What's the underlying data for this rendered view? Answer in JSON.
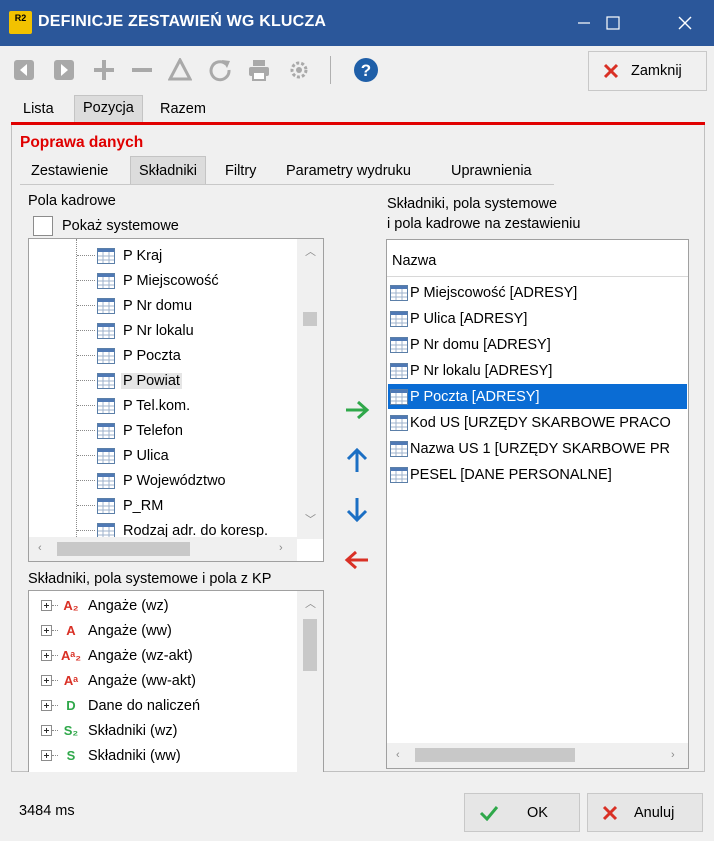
{
  "window": {
    "logo": "R2",
    "title": "DEFINICJE ZESTAWIEŃ WG KLUCZA",
    "icons": [
      "minimize-icon",
      "maximize-icon",
      "close-icon"
    ]
  },
  "toolbar": {
    "icons": [
      "first-record-icon",
      "last-record-icon",
      "add-icon",
      "remove-icon",
      "warning-triangle-icon",
      "refresh-icon",
      "print-icon",
      "settings-icon",
      "help-icon"
    ],
    "close_label": "Zamknij"
  },
  "main_tabs": [
    "Lista",
    "Pozycja",
    "Razem"
  ],
  "section_title": "Poprawa danych",
  "sub_tabs": [
    "Zestawienie",
    "Składniki",
    "Filtry",
    "Parametry wydruku",
    "Uprawnienia"
  ],
  "left_panel": {
    "label": "Pola kadrowe",
    "show_system_label": "Pokaż systemowe",
    "fields": [
      "P Kraj",
      "P Miejscowość",
      "P Nr domu",
      "P Nr lokalu",
      "P Poczta",
      "P Powiat",
      "P Tel.kom.",
      "P Telefon",
      "P Ulica",
      "P Województwo",
      "P_RM",
      "Rodzaj adr. do koresp."
    ],
    "selected_field": "P Powiat",
    "kp_label": "Składniki, pola systemowe i pola z KP",
    "kp_items": [
      {
        "icon": "A₂",
        "label": "Angaże (wz)"
      },
      {
        "icon": "A",
        "label": "Angaże (ww)"
      },
      {
        "icon": "Aᵃ₂",
        "label": "Angaże (wz-akt)"
      },
      {
        "icon": "Aᵃ",
        "label": "Angaże (ww-akt)"
      },
      {
        "icon": "D",
        "label": "Dane do naliczeń"
      },
      {
        "icon": "S₂",
        "label": "Składniki (wz)"
      },
      {
        "icon": "S",
        "label": "Składniki (ww)"
      }
    ]
  },
  "right_panel": {
    "label_line1": "Składniki, pola systemowe",
    "label_line2": "i pola kadrowe na zestawieniu",
    "column_header": "Nazwa",
    "items": [
      "P Miejscowość [ADRESY]",
      "P Ulica [ADRESY]",
      "P Nr domu [ADRESY]",
      "P Nr lokalu [ADRESY]",
      "P Poczta [ADRESY]",
      "Kod US [URZĘDY SKARBOWE PRACO",
      "Nazwa US 1 [URZĘDY SKARBOWE PR",
      "PESEL [DANE PERSONALNE]"
    ],
    "selected_item": "P Poczta [ADRESY]"
  },
  "move_buttons": [
    "add-to-list-arrow-icon",
    "move-up-arrow-icon",
    "move-down-arrow-icon",
    "remove-from-list-arrow-icon"
  ],
  "footer": {
    "status": "3484 ms",
    "ok_label": "OK",
    "cancel_label": "Anuluj"
  },
  "colors": {
    "title_bar": "#2b579a",
    "accent_red": "#e00000",
    "selection_blue": "#0a6cd4",
    "arrow_green": "#2fa84a",
    "arrow_blue": "#1b6fc4"
  }
}
